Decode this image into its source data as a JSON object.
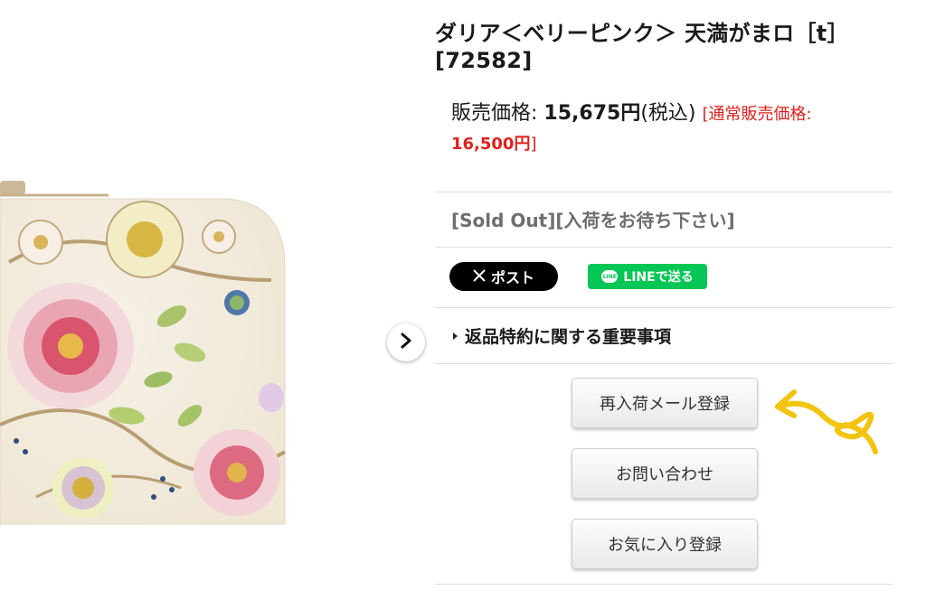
{
  "product": {
    "title": "ダリア＜ベリーピンク＞ 天満がまロ［t］[72582]",
    "price_label": "販売価格:",
    "price_value": "15,675円",
    "tax_note": "(税込)",
    "regular_prefix": "[通常販売価格:",
    "regular_value": "16,500円",
    "regular_suffix": "]",
    "status": "[Sold Out][入荷をお待ち下さい]"
  },
  "share": {
    "x_label": "ポスト",
    "line_badge": "LINE",
    "line_label": "LINEで送る"
  },
  "policy": {
    "label": "返品特約に関する重要事項"
  },
  "buttons": {
    "restock": "再入荷メール登録",
    "inquiry": "お問い合わせ",
    "favorite": "お気に入り登録"
  },
  "colors": {
    "accent_red": "#e0201a",
    "line_green": "#06c755",
    "annotation_yellow": "#f2c40f"
  },
  "icons": {
    "next": "chevron-right-icon",
    "x": "x-logo-icon",
    "line": "line-logo-icon"
  }
}
